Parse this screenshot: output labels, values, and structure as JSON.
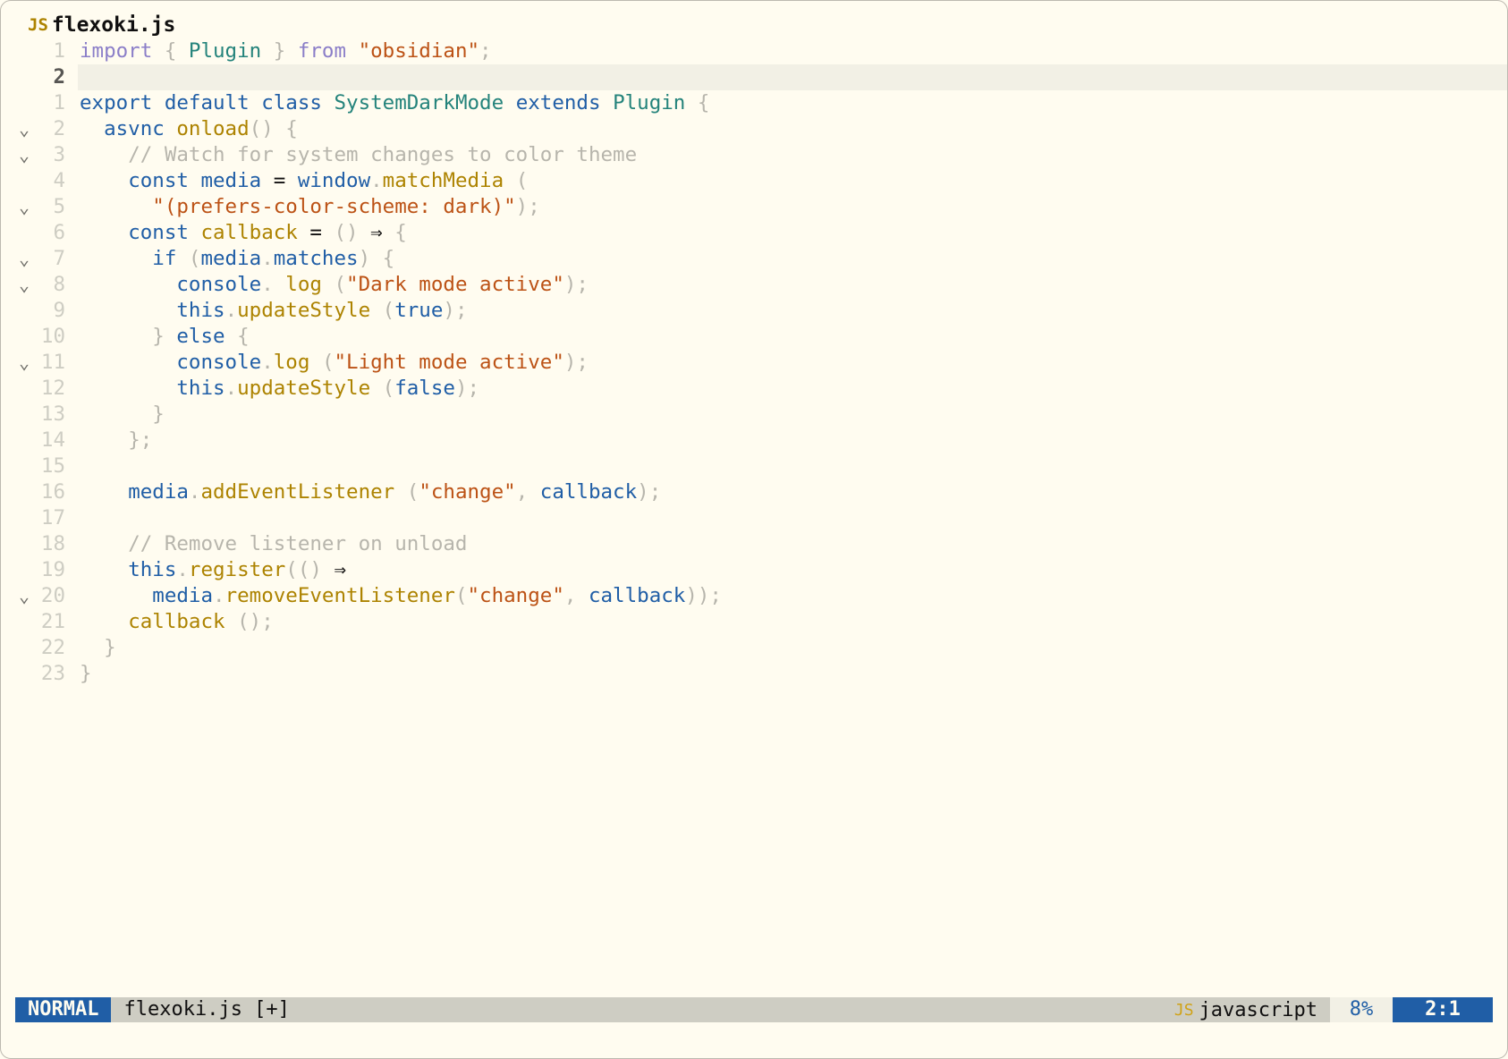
{
  "tab": {
    "icon": "JS",
    "filename": "flexoki.js"
  },
  "colors": {
    "background": "#FFFCF0",
    "keyword": "#205EA6",
    "import_keyword": "#8B7EC8",
    "type": "#24837B",
    "function": "#AD8301",
    "string": "#BC5215",
    "comment": "#B7B5AC",
    "punctuation": "#B7B5AC",
    "text": "#100F0F",
    "statusline_mode_bg": "#205EA6",
    "statusline_bg": "#CECDC3"
  },
  "editor": {
    "lines": [
      {
        "num": "1",
        "fold": "",
        "text": "import { Plugin } from \"obsidian\";",
        "tokens": [
          {
            "t": "import",
            "c": "import_keyword"
          },
          {
            "t": " "
          },
          {
            "t": "{",
            "c": "punctuation"
          },
          {
            "t": " "
          },
          {
            "t": "Plugin",
            "c": "type"
          },
          {
            "t": " "
          },
          {
            "t": "}",
            "c": "punctuation"
          },
          {
            "t": " "
          },
          {
            "t": "from",
            "c": "import_keyword"
          },
          {
            "t": " "
          },
          {
            "t": "\"obsidian\"",
            "c": "string"
          },
          {
            "t": ";",
            "c": "punctuation"
          }
        ]
      },
      {
        "num": "2",
        "fold": "",
        "current": true,
        "text": "",
        "tokens": []
      },
      {
        "num": "1",
        "fold": "",
        "text": "export default class SystemDarkMode extends Plugin {",
        "tokens": [
          {
            "t": "export",
            "c": "keyword"
          },
          {
            "t": " "
          },
          {
            "t": "default",
            "c": "keyword"
          },
          {
            "t": " "
          },
          {
            "t": "class",
            "c": "keyword"
          },
          {
            "t": " "
          },
          {
            "t": "SystemDarkMode",
            "c": "type"
          },
          {
            "t": " "
          },
          {
            "t": "extends",
            "c": "keyword"
          },
          {
            "t": " "
          },
          {
            "t": "Plugin",
            "c": "type"
          },
          {
            "t": " "
          },
          {
            "t": "{",
            "c": "punctuation"
          }
        ]
      },
      {
        "num": "2",
        "fold": "⌄",
        "text": "  asvnc onload() {",
        "tokens": [
          {
            "t": "  "
          },
          {
            "t": "asvnc",
            "c": "keyword"
          },
          {
            "t": " "
          },
          {
            "t": "onload",
            "c": "function"
          },
          {
            "t": "()",
            "c": "punctuation"
          },
          {
            "t": " "
          },
          {
            "t": "{",
            "c": "punctuation"
          }
        ]
      },
      {
        "num": "3",
        "fold": "⌄",
        "text": "    // Watch for system changes to color theme",
        "tokens": [
          {
            "t": "    "
          },
          {
            "t": "// Watch for system changes to color theme",
            "c": "comment"
          }
        ]
      },
      {
        "num": "4",
        "fold": "",
        "text": "    const media = window.matchMedia (",
        "tokens": [
          {
            "t": "    "
          },
          {
            "t": "const",
            "c": "keyword"
          },
          {
            "t": " "
          },
          {
            "t": "media",
            "c": "keyword"
          },
          {
            "t": " "
          },
          {
            "t": "=",
            "c": "text"
          },
          {
            "t": " "
          },
          {
            "t": "window",
            "c": "keyword"
          },
          {
            "t": ".",
            "c": "punctuation"
          },
          {
            "t": "matchMedia",
            "c": "function"
          },
          {
            "t": " "
          },
          {
            "t": "(",
            "c": "punctuation"
          }
        ]
      },
      {
        "num": "5",
        "fold": "⌄",
        "text": "      \"(prefers-color-scheme: dark)\");",
        "tokens": [
          {
            "t": "      "
          },
          {
            "t": "\"(prefers-color-scheme: dark)\"",
            "c": "string"
          },
          {
            "t": ");",
            "c": "punctuation"
          }
        ]
      },
      {
        "num": "6",
        "fold": "",
        "text": "    const callback = () ⇒ {",
        "tokens": [
          {
            "t": "    "
          },
          {
            "t": "const",
            "c": "keyword"
          },
          {
            "t": " "
          },
          {
            "t": "callback",
            "c": "function"
          },
          {
            "t": " "
          },
          {
            "t": "=",
            "c": "text"
          },
          {
            "t": " "
          },
          {
            "t": "()",
            "c": "punctuation"
          },
          {
            "t": " "
          },
          {
            "t": "⇒",
            "c": "text"
          },
          {
            "t": " "
          },
          {
            "t": "{",
            "c": "punctuation"
          }
        ]
      },
      {
        "num": "7",
        "fold": "⌄",
        "text": "      if (media.matches) {",
        "tokens": [
          {
            "t": "      "
          },
          {
            "t": "if",
            "c": "keyword"
          },
          {
            "t": " "
          },
          {
            "t": "(",
            "c": "punctuation"
          },
          {
            "t": "media",
            "c": "keyword"
          },
          {
            "t": ".",
            "c": "punctuation"
          },
          {
            "t": "matches",
            "c": "keyword"
          },
          {
            "t": ")",
            "c": "punctuation"
          },
          {
            "t": " "
          },
          {
            "t": "{",
            "c": "punctuation"
          }
        ]
      },
      {
        "num": "8",
        "fold": "⌄",
        "text": "        console. log (\"Dark mode active\");",
        "tokens": [
          {
            "t": "        "
          },
          {
            "t": "console",
            "c": "keyword"
          },
          {
            "t": ".",
            "c": "punctuation"
          },
          {
            "t": " "
          },
          {
            "t": "log",
            "c": "function"
          },
          {
            "t": " "
          },
          {
            "t": "(",
            "c": "punctuation"
          },
          {
            "t": "\"Dark mode active\"",
            "c": "string"
          },
          {
            "t": ");",
            "c": "punctuation"
          }
        ]
      },
      {
        "num": "9",
        "fold": "",
        "text": "        this.updateStyle (true);",
        "tokens": [
          {
            "t": "        "
          },
          {
            "t": "this",
            "c": "keyword"
          },
          {
            "t": ".",
            "c": "punctuation"
          },
          {
            "t": "updateStyle",
            "c": "function"
          },
          {
            "t": " "
          },
          {
            "t": "(",
            "c": "punctuation"
          },
          {
            "t": "true",
            "c": "keyword"
          },
          {
            "t": ");",
            "c": "punctuation"
          }
        ]
      },
      {
        "num": "10",
        "fold": "",
        "text": "      } else {",
        "tokens": [
          {
            "t": "      "
          },
          {
            "t": "}",
            "c": "punctuation"
          },
          {
            "t": " "
          },
          {
            "t": "else",
            "c": "keyword"
          },
          {
            "t": " "
          },
          {
            "t": "{",
            "c": "punctuation"
          }
        ]
      },
      {
        "num": "11",
        "fold": "⌄",
        "text": "        console.log (\"Light mode active\");",
        "tokens": [
          {
            "t": "        "
          },
          {
            "t": "console",
            "c": "keyword"
          },
          {
            "t": ".",
            "c": "punctuation"
          },
          {
            "t": "log",
            "c": "function"
          },
          {
            "t": " "
          },
          {
            "t": "(",
            "c": "punctuation"
          },
          {
            "t": "\"Light mode active\"",
            "c": "string"
          },
          {
            "t": ");",
            "c": "punctuation"
          }
        ]
      },
      {
        "num": "12",
        "fold": "",
        "text": "        this.updateStyle (false);",
        "tokens": [
          {
            "t": "        "
          },
          {
            "t": "this",
            "c": "keyword"
          },
          {
            "t": ".",
            "c": "punctuation"
          },
          {
            "t": "updateStyle",
            "c": "function"
          },
          {
            "t": " "
          },
          {
            "t": "(",
            "c": "punctuation"
          },
          {
            "t": "false",
            "c": "keyword"
          },
          {
            "t": ");",
            "c": "punctuation"
          }
        ]
      },
      {
        "num": "13",
        "fold": "",
        "text": "      }",
        "tokens": [
          {
            "t": "      "
          },
          {
            "t": "}",
            "c": "punctuation"
          }
        ]
      },
      {
        "num": "14",
        "fold": "",
        "text": "    };",
        "tokens": [
          {
            "t": "    "
          },
          {
            "t": "};",
            "c": "punctuation"
          }
        ]
      },
      {
        "num": "15",
        "fold": "",
        "text": "",
        "tokens": []
      },
      {
        "num": "16",
        "fold": "",
        "text": "    media.addEventListener (\"change\", callback);",
        "tokens": [
          {
            "t": "    "
          },
          {
            "t": "media",
            "c": "keyword"
          },
          {
            "t": ".",
            "c": "punctuation"
          },
          {
            "t": "addEventListener",
            "c": "function"
          },
          {
            "t": " "
          },
          {
            "t": "(",
            "c": "punctuation"
          },
          {
            "t": "\"change\"",
            "c": "string"
          },
          {
            "t": ",",
            "c": "punctuation"
          },
          {
            "t": " "
          },
          {
            "t": "callback",
            "c": "keyword"
          },
          {
            "t": ");",
            "c": "punctuation"
          }
        ]
      },
      {
        "num": "17",
        "fold": "",
        "text": "",
        "tokens": []
      },
      {
        "num": "18",
        "fold": "",
        "text": "    // Remove listener on unload",
        "tokens": [
          {
            "t": "    "
          },
          {
            "t": "// Remove listener on unload",
            "c": "comment"
          }
        ]
      },
      {
        "num": "19",
        "fold": "",
        "text": "    this.register(() ⇒",
        "tokens": [
          {
            "t": "    "
          },
          {
            "t": "this",
            "c": "keyword"
          },
          {
            "t": ".",
            "c": "punctuation"
          },
          {
            "t": "register",
            "c": "function"
          },
          {
            "t": "(()",
            "c": "punctuation"
          },
          {
            "t": " "
          },
          {
            "t": "⇒",
            "c": "text"
          }
        ]
      },
      {
        "num": "20",
        "fold": "⌄",
        "text": "      media.removeEventListener(\"change\", callback));",
        "tokens": [
          {
            "t": "      "
          },
          {
            "t": "media",
            "c": "keyword"
          },
          {
            "t": ".",
            "c": "punctuation"
          },
          {
            "t": "removeEventListener",
            "c": "function"
          },
          {
            "t": "(",
            "c": "punctuation"
          },
          {
            "t": "\"change\"",
            "c": "string"
          },
          {
            "t": ",",
            "c": "punctuation"
          },
          {
            "t": " "
          },
          {
            "t": "callback",
            "c": "keyword"
          },
          {
            "t": "));",
            "c": "punctuation"
          }
        ]
      },
      {
        "num": "21",
        "fold": "",
        "text": "    callback ();",
        "tokens": [
          {
            "t": "    "
          },
          {
            "t": "callback",
            "c": "function"
          },
          {
            "t": " "
          },
          {
            "t": "();",
            "c": "punctuation"
          }
        ]
      },
      {
        "num": "22",
        "fold": "",
        "text": "  }",
        "tokens": [
          {
            "t": "  "
          },
          {
            "t": "}",
            "c": "punctuation"
          }
        ]
      },
      {
        "num": "23",
        "fold": "",
        "text": "}",
        "tokens": [
          {
            "t": "}",
            "c": "punctuation"
          }
        ]
      }
    ]
  },
  "statusline": {
    "mode": "NORMAL",
    "file": "flexoki.js [+]",
    "filetype_icon": "JS",
    "filetype": "javascript",
    "percent": "8%",
    "position": "2:1"
  }
}
